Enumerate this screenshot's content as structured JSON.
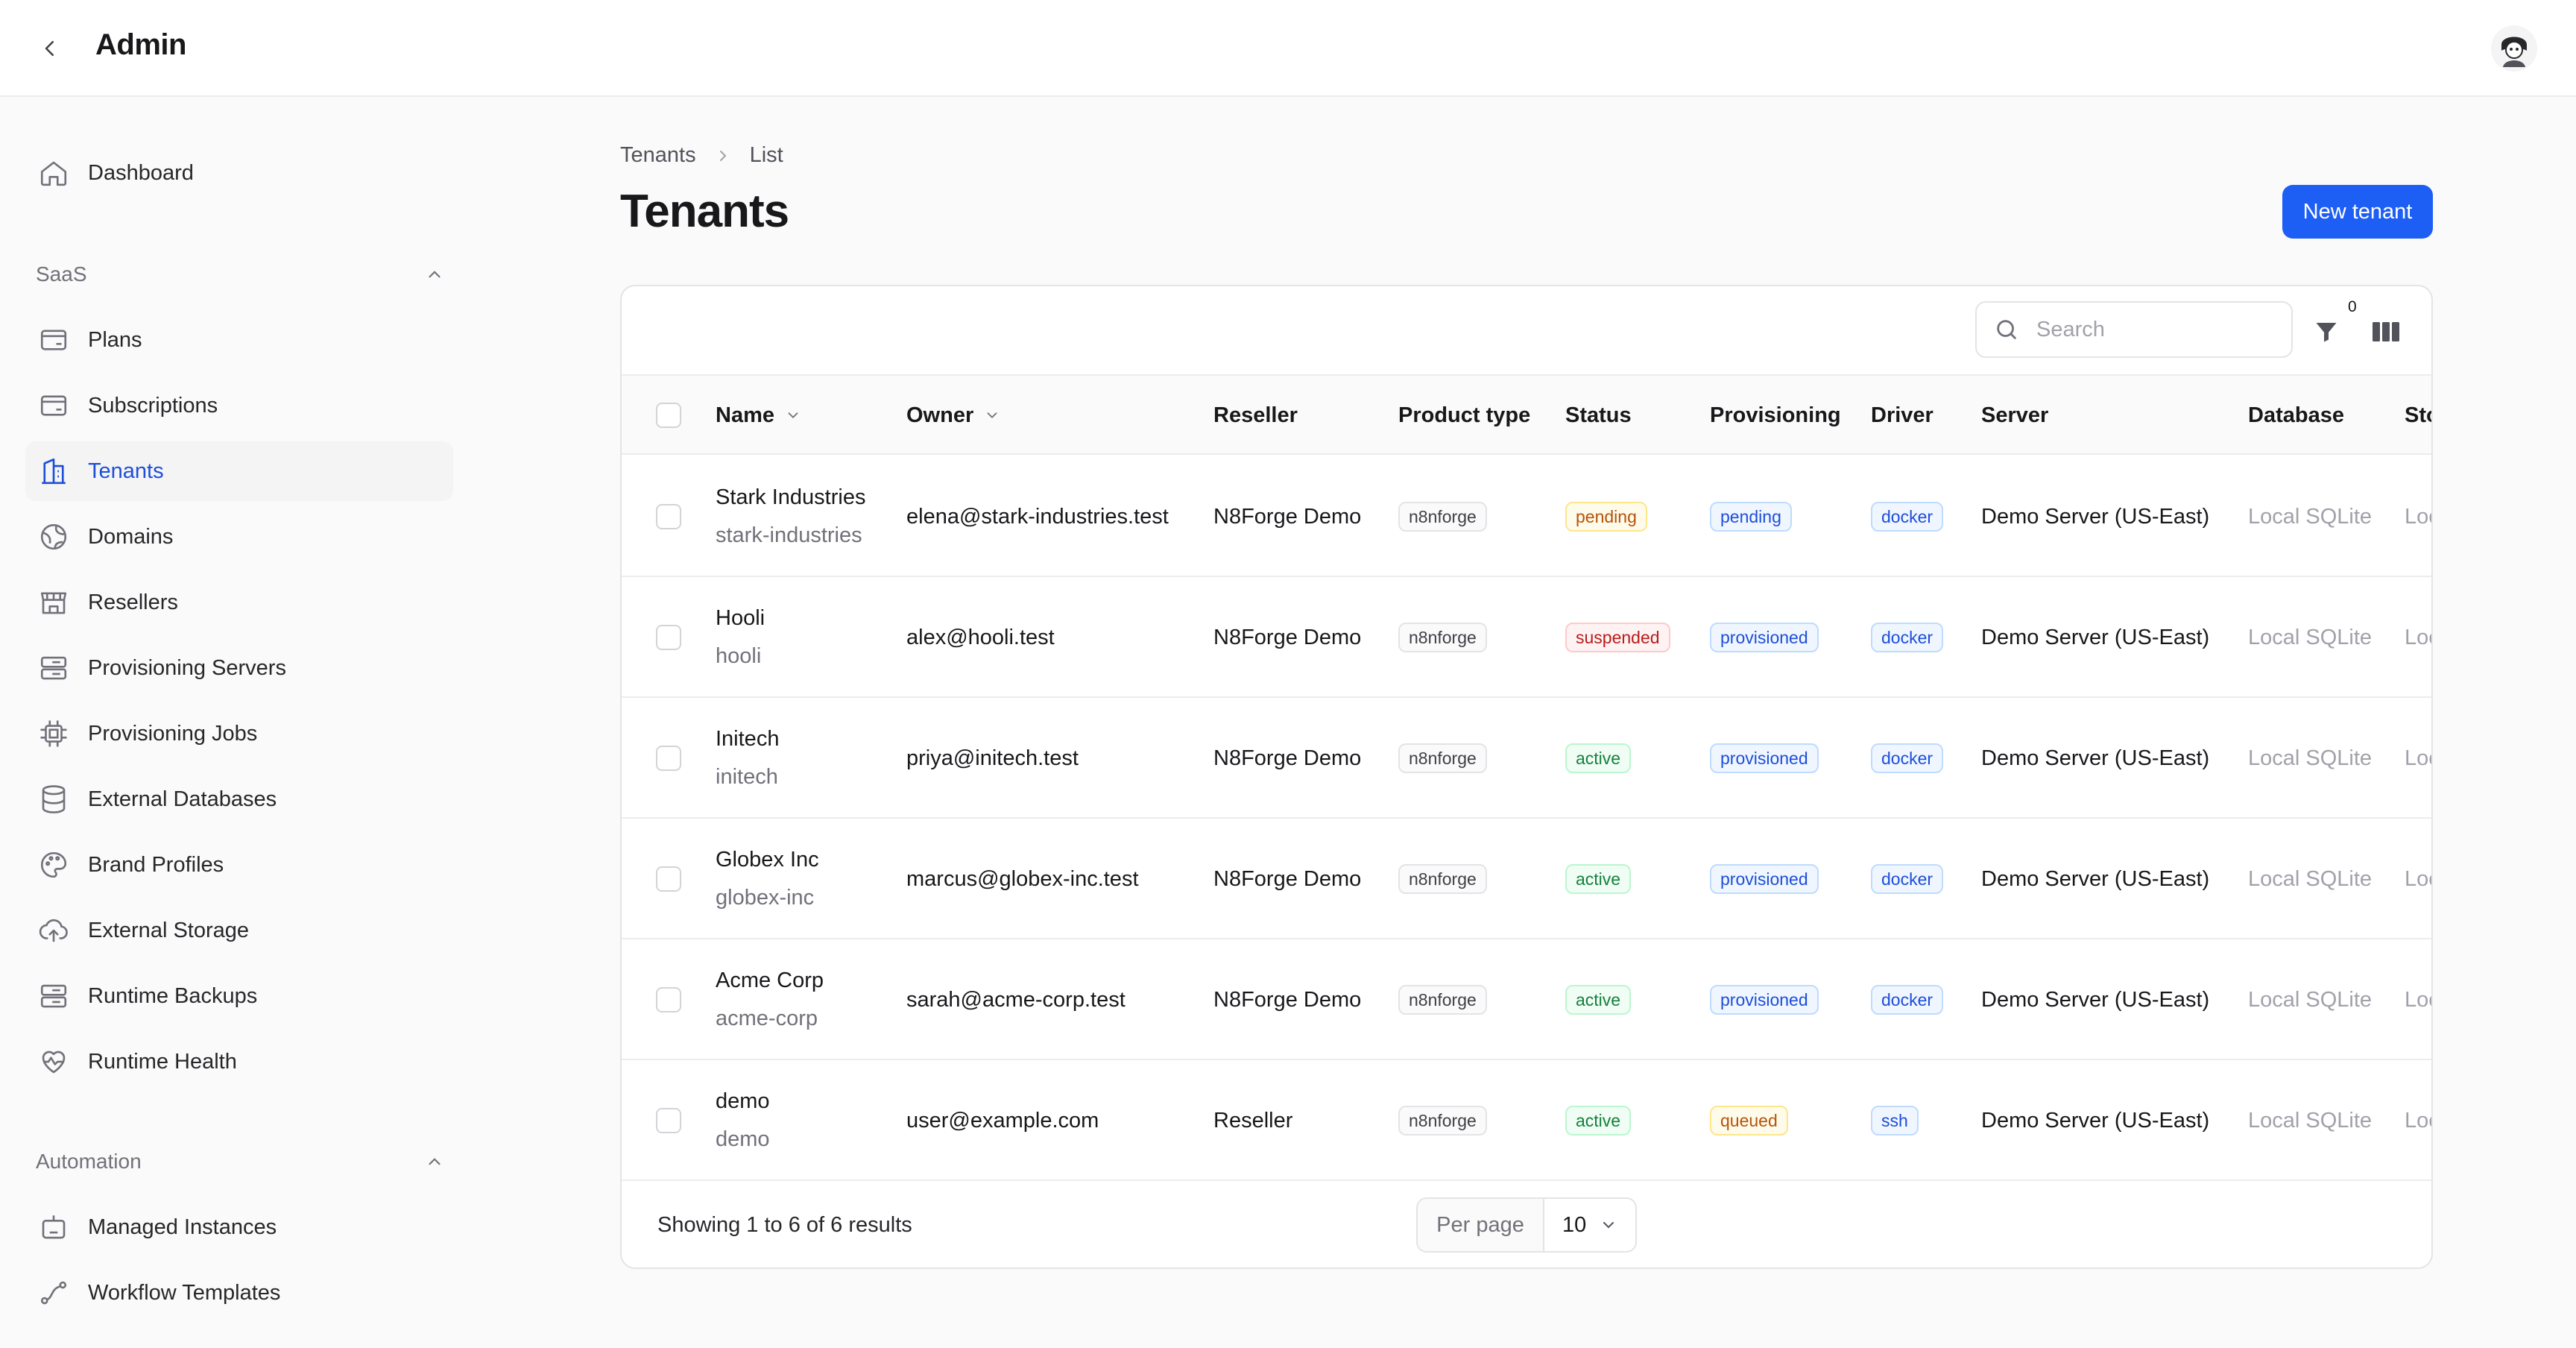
{
  "app": {
    "title": "Admin"
  },
  "sidebar": {
    "top_items": [
      {
        "label": "Dashboard",
        "icon": "home-icon"
      }
    ],
    "groups": [
      {
        "label": "SaaS",
        "items": [
          {
            "label": "Plans",
            "icon": "credit-card-icon"
          },
          {
            "label": "Subscriptions",
            "icon": "credit-card-icon"
          },
          {
            "label": "Tenants",
            "icon": "building-icon",
            "active": true
          },
          {
            "label": "Domains",
            "icon": "globe-icon"
          },
          {
            "label": "Resellers",
            "icon": "storefront-icon"
          },
          {
            "label": "Provisioning Servers",
            "icon": "server-icon"
          },
          {
            "label": "Provisioning Jobs",
            "icon": "cpu-chip-icon"
          },
          {
            "label": "External Databases",
            "icon": "database-icon"
          },
          {
            "label": "Brand Profiles",
            "icon": "palette-icon"
          },
          {
            "label": "External Storage",
            "icon": "cloud-upload-icon"
          },
          {
            "label": "Runtime Backups",
            "icon": "server-icon"
          },
          {
            "label": "Runtime Health",
            "icon": "heart-pulse-icon"
          }
        ]
      },
      {
        "label": "Automation",
        "items": [
          {
            "label": "Managed Instances",
            "icon": "robot-icon"
          },
          {
            "label": "Workflow Templates",
            "icon": "workflow-icon"
          }
        ]
      }
    ]
  },
  "breadcrumb": [
    "Tenants",
    "List"
  ],
  "page": {
    "title": "Tenants",
    "new_button": "New tenant"
  },
  "toolbar": {
    "search_placeholder": "Search",
    "filter_count": "0"
  },
  "table": {
    "columns": [
      "Name",
      "Owner",
      "Reseller",
      "Product type",
      "Status",
      "Provisioning",
      "Driver",
      "Server",
      "Database",
      "Sto"
    ],
    "rows": [
      {
        "name": "Stark Industries",
        "slug": "stark-industries",
        "owner": "elena@stark-industries.test",
        "reseller": "N8Forge Demo",
        "product": "n8nforge",
        "status": "pending",
        "provisioning": "pending",
        "driver": "docker",
        "server": "Demo Server (US-East)",
        "database": "Local SQLite",
        "storage": "Loc"
      },
      {
        "name": "Hooli",
        "slug": "hooli",
        "owner": "alex@hooli.test",
        "reseller": "N8Forge Demo",
        "product": "n8nforge",
        "status": "suspended",
        "provisioning": "provisioned",
        "driver": "docker",
        "server": "Demo Server (US-East)",
        "database": "Local SQLite",
        "storage": "Loc"
      },
      {
        "name": "Initech",
        "slug": "initech",
        "owner": "priya@initech.test",
        "reseller": "N8Forge Demo",
        "product": "n8nforge",
        "status": "active",
        "provisioning": "provisioned",
        "driver": "docker",
        "server": "Demo Server (US-East)",
        "database": "Local SQLite",
        "storage": "Loc"
      },
      {
        "name": "Globex Inc",
        "slug": "globex-inc",
        "owner": "marcus@globex-inc.test",
        "reseller": "N8Forge Demo",
        "product": "n8nforge",
        "status": "active",
        "provisioning": "provisioned",
        "driver": "docker",
        "server": "Demo Server (US-East)",
        "database": "Local SQLite",
        "storage": "Loc"
      },
      {
        "name": "Acme Corp",
        "slug": "acme-corp",
        "owner": "sarah@acme-corp.test",
        "reseller": "N8Forge Demo",
        "product": "n8nforge",
        "status": "active",
        "provisioning": "provisioned",
        "driver": "docker",
        "server": "Demo Server (US-East)",
        "database": "Local SQLite",
        "storage": "Loc"
      },
      {
        "name": "demo",
        "slug": "demo",
        "owner": "user@example.com",
        "reseller": "Reseller",
        "product": "n8nforge",
        "status": "active",
        "provisioning": "queued",
        "driver": "ssh",
        "server": "Demo Server (US-East)",
        "database": "Local SQLite",
        "storage": "Loc"
      }
    ]
  },
  "footer": {
    "results_text": "Showing 1 to 6 of 6 results",
    "per_page_label": "Per page",
    "per_page_value": "10"
  },
  "colors": {
    "accent": "#1d5ef5",
    "active_nav_text": "#1d4ed8"
  }
}
